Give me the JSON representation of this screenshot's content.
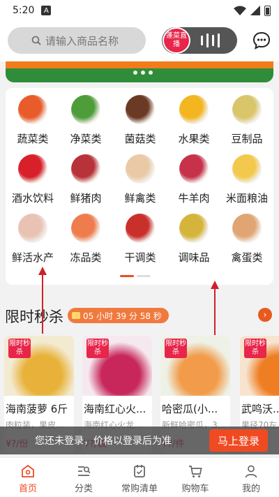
{
  "status_bar": {
    "time": "5:20",
    "a_badge": "A"
  },
  "header": {
    "search_placeholder": "请输入商品名称",
    "live_badge": "蓬菜直播"
  },
  "categories": [
    {
      "label": "蔬菜类",
      "color": "#e95b2a",
      "icon": "vegetables-icon"
    },
    {
      "label": "净菜类",
      "color": "#4e9d3a",
      "icon": "cabbage-icon"
    },
    {
      "label": "菌菇类",
      "color": "#6b3a25",
      "icon": "mushroom-icon"
    },
    {
      "label": "水果类",
      "color": "#f3b520",
      "icon": "fruit-icon"
    },
    {
      "label": "豆制品",
      "color": "#d9c56a",
      "icon": "soy-icon"
    },
    {
      "label": "酒水饮料",
      "color": "#d7202a",
      "icon": "drinks-icon"
    },
    {
      "label": "鲜猪肉",
      "color": "#b8323a",
      "icon": "pork-icon"
    },
    {
      "label": "鲜禽类",
      "color": "#e9c9a6",
      "icon": "poultry-icon"
    },
    {
      "label": "牛羊肉",
      "color": "#c7324a",
      "icon": "beef-icon"
    },
    {
      "label": "米面粮油",
      "color": "#f2c94c",
      "icon": "grain-oil-icon"
    },
    {
      "label": "鲜活水产",
      "color": "#e9c2b4",
      "icon": "seafood-icon"
    },
    {
      "label": "冻品类",
      "color": "#ef7c4d",
      "icon": "frozen-icon"
    },
    {
      "label": "干调类",
      "color": "#c9302c",
      "icon": "dried-spice-icon"
    },
    {
      "label": "调味品",
      "color": "#d4b43a",
      "icon": "seasoning-icon"
    },
    {
      "label": "禽蛋类",
      "color": "#e0a572",
      "icon": "eggs-icon"
    }
  ],
  "flash_sale": {
    "title": "限时秒杀",
    "countdown": "05 小时 39 分 58 秒",
    "more_arrow": "›"
  },
  "products": [
    {
      "tag": "限时秒杀",
      "name": "海南菠萝 6斤",
      "desc": "肉粒装，果皮...",
      "price": "¥?/份",
      "bg": "#f3ead2",
      "accent": "#e8b23a"
    },
    {
      "tag": "限时秒杀",
      "name": "海南红心火...",
      "desc": "海南红心火龙...",
      "price": "¥?/袋",
      "bg": "#f5e9ef",
      "accent": "#c8275b"
    },
    {
      "tag": "限时秒杀",
      "name": "哈密瓜(小...",
      "desc": "新鲜哈密瓜，3...",
      "price": "¥?/件",
      "bg": "#eef2e6",
      "accent": "#f29b4a"
    },
    {
      "tag": "限时秒杀",
      "name": "武鸣沃...",
      "desc": "果径70左...",
      "price": "¥?/...",
      "bg": "#f7e4cf",
      "accent": "#ef7d22"
    }
  ],
  "login_bar": {
    "message": "您还未登录，价格以登录后为准",
    "button": "马上登录"
  },
  "tabs": [
    {
      "label": "首页",
      "icon": "home-icon",
      "active": true
    },
    {
      "label": "分类",
      "icon": "category-icon",
      "active": false
    },
    {
      "label": "常购清单",
      "icon": "list-icon",
      "active": false
    },
    {
      "label": "购物车",
      "icon": "cart-icon",
      "active": false
    },
    {
      "label": "我的",
      "icon": "profile-icon",
      "active": false
    }
  ],
  "colors": {
    "brand": "#f04a23",
    "live": "#e8254a",
    "banner": "#2f8d3a"
  }
}
